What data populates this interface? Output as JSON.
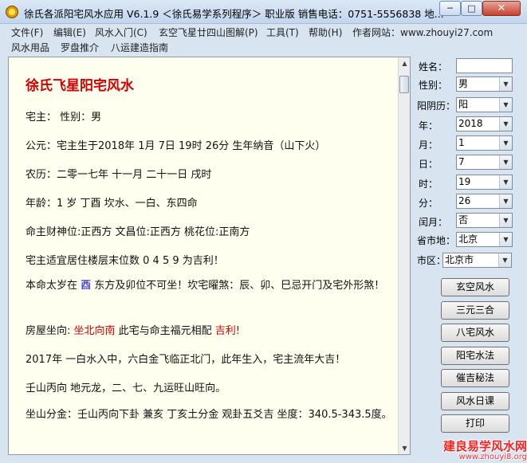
{
  "window": {
    "title": "徐氏各派阳宅风水应用 V6.1.9 ＜徐氏易学系列程序＞ 职业版 销售电话：0751-5556838 地...",
    "min_label": "─",
    "max_label": "□",
    "close_label": "✕"
  },
  "menu": [
    "文件(F)",
    "编辑(E)",
    "风水入门(C)",
    "玄空飞星廿四山图解(P)",
    "工具(T)",
    "帮助(H)",
    "作者网站：www.zhouyi27.com"
  ],
  "toolbar": [
    "风水用品",
    "罗盘推介",
    "八运建造指南"
  ],
  "document": {
    "title": "徐氏飞星阳宅风水",
    "owner": "宅主：  性别：男",
    "birth": "公元：宅主生于2018年  1月  7日  19时  26分  生年纳音（山下火）",
    "lunar": "农历：二零一七年  十一月  二十一日  戌时",
    "age": "年龄：1 岁    丁酉    坎水、一白、东四命",
    "positions": "命主财神位:正西方    文昌位:正西方    桃花位:正南方",
    "floors": "宅主适宜居住楼层末位数  0  4  5  9  为吉利！",
    "taisui_pre": "本命太岁在  ",
    "taisui_dir": "酉",
    "taisui_post": "  东方及卯位不可坐！坎宅曜煞：辰、卯、巳忌开门及宅外形煞！",
    "house_pre": "房屋坐向:  ",
    "house_dir": "坐北向南",
    "house_mid": "  此宅与命主福元相配  ",
    "house_result": "吉利!",
    "year_line": "2017年  一白水入中，六白金飞临正北门，此年生入，宅主流年大吉！",
    "mountain": "壬山丙向  地元龙，二、七、九运旺山旺向。",
    "division": "坐山分金：壬山丙向下卦    兼亥    丁亥土分金  观卦五爻吉  坐度：340.5-343.5度。"
  },
  "form": {
    "name_label": "姓名：",
    "name_value": "",
    "gender_label": "性别：",
    "gender_value": "男",
    "calendar_label": "阳阴历：",
    "calendar_value": "阳",
    "year_label": "年：",
    "year_value": "2018",
    "month_label": "月：",
    "month_value": "1",
    "day_label": "日：",
    "day_value": "7",
    "hour_label": "时：",
    "hour_value": "19",
    "minute_label": "分：",
    "minute_value": "26",
    "leap_label": "闰月：",
    "leap_value": "否",
    "province_label": "省市地：",
    "province_value": "北京",
    "district_label": "市区：",
    "district_value": "北京市"
  },
  "buttons": [
    "玄空风水",
    "三元三合",
    "八宅风水",
    "阳宅水法",
    "催吉秘法",
    "风水日课",
    "打印"
  ],
  "watermark": {
    "title": "建良易学风水网",
    "url": "www.zhouyi8.org"
  },
  "colors": {
    "title_red": "#d40000",
    "highlight_blue": "#0000d0",
    "paper": "#fffff0"
  }
}
